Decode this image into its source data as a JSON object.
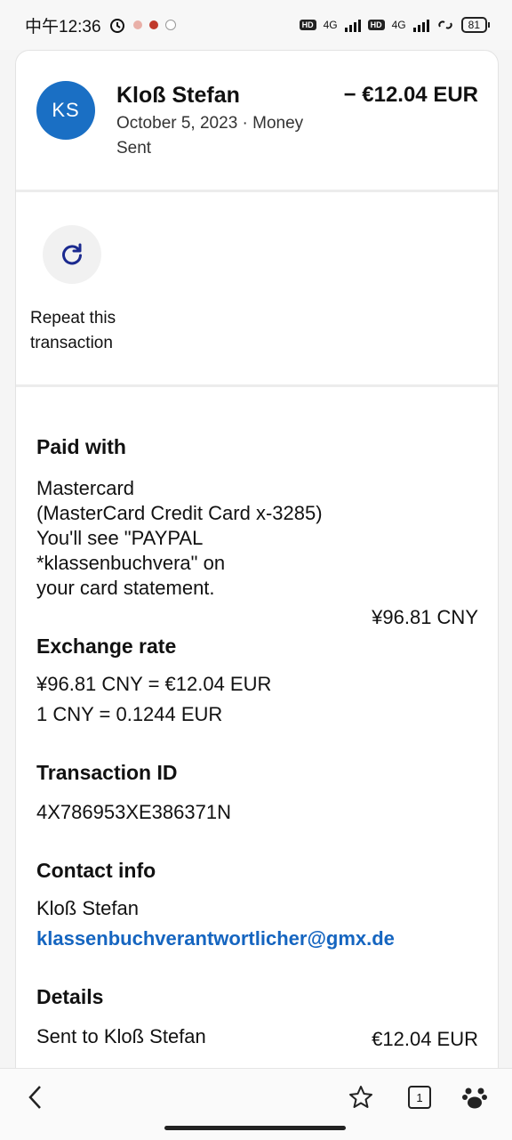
{
  "status_bar": {
    "time": "中午12:36",
    "net_type": "4G",
    "battery": "81"
  },
  "header": {
    "avatar_initials": "KS",
    "name": "Kloß Stefan",
    "amount": "− €12.04 EUR",
    "date_line": "October 5, 2023 · Money Sent"
  },
  "repeat": {
    "label": "Repeat this transaction"
  },
  "paid_with": {
    "title": "Paid with",
    "line1": "Mastercard",
    "line2": "(MasterCard Credit Card x-3285)",
    "line3": "You'll see \"PAYPAL",
    "line4": "*klassenbuchvera\" on",
    "line5": "your card statement.",
    "amount": "¥96.81 CNY"
  },
  "exchange": {
    "title": "Exchange rate",
    "line1": "¥96.81 CNY = €12.04 EUR",
    "line2": "1 CNY = 0.1244 EUR"
  },
  "transaction": {
    "title": "Transaction ID",
    "id": "4X786953XE386371N"
  },
  "contact": {
    "title": "Contact info",
    "name": "Kloß Stefan",
    "email": "klassenbuchverantwortlicher@gmx.de"
  },
  "details": {
    "title": "Details",
    "sent_to": "Sent to Kloß Stefan",
    "amount": "€12.04 EUR"
  },
  "bottom_nav": {
    "tab_count": "1"
  },
  "colors": {
    "avatar": "#1a6fc4",
    "link": "#1565c0",
    "repeat_icon": "#1b2a8f"
  }
}
